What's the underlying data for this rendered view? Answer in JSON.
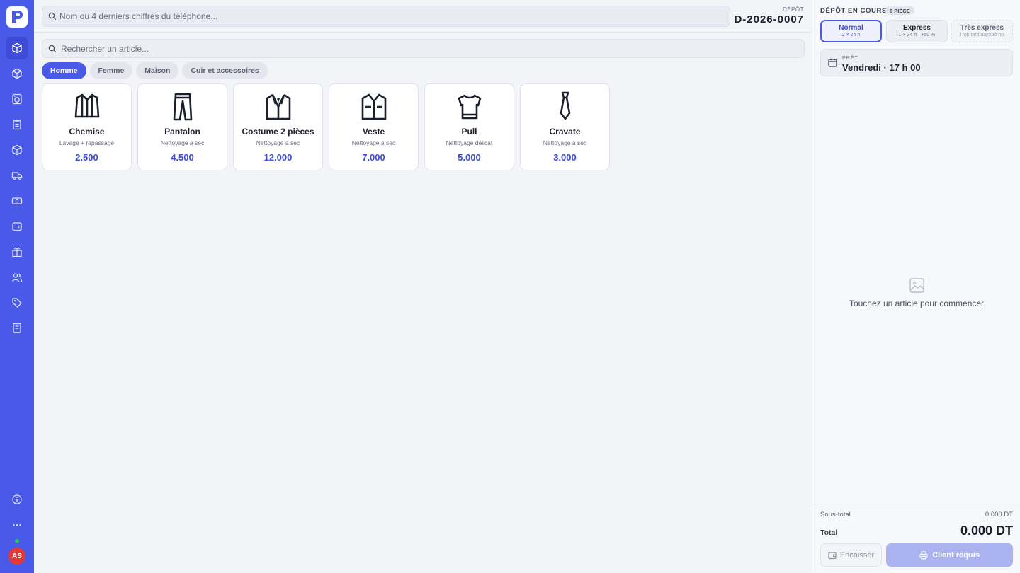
{
  "sidebar": {
    "logo": "pressing-logo",
    "items": [
      {
        "icon": "cube-icon",
        "active": true
      },
      {
        "icon": "cube-icon"
      },
      {
        "icon": "washing-machine-icon"
      },
      {
        "icon": "clipboard-icon"
      },
      {
        "icon": "cube-icon"
      },
      {
        "icon": "delivery-truck-icon"
      },
      {
        "icon": "money-icon"
      },
      {
        "icon": "wallet-icon"
      },
      {
        "icon": "gift-icon"
      },
      {
        "icon": "users-icon"
      },
      {
        "icon": "tags-icon"
      },
      {
        "icon": "receipt-icon"
      }
    ],
    "bottom_items": [
      {
        "icon": "info-icon"
      },
      {
        "icon": "more-icon"
      }
    ],
    "user_initials": "AS",
    "online_color": "#22c55e"
  },
  "header": {
    "client_search_placeholder": "Nom ou 4 derniers chiffres du téléphone...",
    "depot_label": "DÉPÔT",
    "depot_number": "D-2026-0007"
  },
  "catalog": {
    "search_placeholder": "Rechercher un article...",
    "tabs": [
      {
        "label": "Homme",
        "active": true
      },
      {
        "label": "Femme"
      },
      {
        "label": "Maison"
      },
      {
        "label": "Cuir et accessoires"
      }
    ],
    "items": [
      {
        "icon": "shirt-icon",
        "name": "Chemise",
        "service": "Lavage + repassage",
        "price": "2.500"
      },
      {
        "icon": "trousers-icon",
        "name": "Pantalon",
        "service": "Nettoyage à sec",
        "price": "4.500"
      },
      {
        "icon": "suit-icon",
        "name": "Costume 2 pièces",
        "service": "Nettoyage à sec",
        "price": "12.000"
      },
      {
        "icon": "jacket-icon",
        "name": "Veste",
        "service": "Nettoyage à sec",
        "price": "7.000"
      },
      {
        "icon": "sweater-icon",
        "name": "Pull",
        "service": "Nettoyage délicat",
        "price": "5.000"
      },
      {
        "icon": "tie-icon",
        "name": "Cravate",
        "service": "Nettoyage à sec",
        "price": "3.000"
      }
    ]
  },
  "order": {
    "title": "DÉPÔT EN COURS",
    "piece_count": "0 PIÈCE",
    "speeds": [
      {
        "title": "Normal",
        "sub": "2 × 24 h",
        "state": "active"
      },
      {
        "title": "Express",
        "sub": "1 × 24 h · +50 %",
        "state": "normal"
      },
      {
        "title": "Très express",
        "sub": "Trop tard aujourd'hui",
        "state": "disabled"
      }
    ],
    "ready_label": "PRÊT",
    "ready_value": "Vendredi · 17 h 00",
    "empty_text": "Touchez un article pour commencer",
    "subtotal_label": "Sous-total",
    "subtotal_value": "0.000 DT",
    "total_label": "Total",
    "total_value": "0.000 DT",
    "cash_button": "Encaisser",
    "client_button": "Client requis"
  },
  "colors": {
    "accent": "#4a5ae8",
    "price": "#3d4bd6",
    "avatar": "#e53935"
  }
}
